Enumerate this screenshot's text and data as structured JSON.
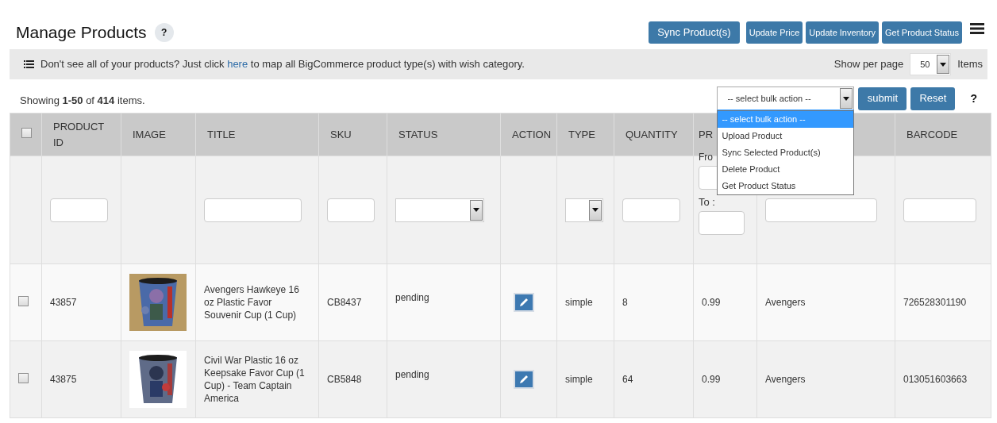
{
  "header": {
    "title": "Manage Products",
    "help": "?",
    "buttons": [
      {
        "label": "Sync Product(s)",
        "kind": "large"
      },
      {
        "label": "Update Price",
        "kind": "small"
      },
      {
        "label": "Update Inventory",
        "kind": "small"
      },
      {
        "label": "Get Product Status",
        "kind": "small"
      }
    ]
  },
  "notice": {
    "before": "Don't see all of your products? Just click",
    "link": "here",
    "after": "to map all BigCommerce product type(s) with wish category."
  },
  "per_page": {
    "label": "Show per page",
    "value": "50",
    "suffix": "Items"
  },
  "summary": "Showing **1-50** of **414** items.",
  "bulk": {
    "value": "-- select bulk action --",
    "expanded": true,
    "submit": "submit",
    "reset": "Reset",
    "help": "?",
    "options": [
      {
        "label": "-- select bulk action --",
        "selected": true
      },
      {
        "label": "Upload Product",
        "selected": false
      },
      {
        "label": "Sync Selected Product(s)",
        "selected": false
      },
      {
        "label": "Delete Product",
        "selected": false
      },
      {
        "label": "Get Product Status",
        "selected": false
      }
    ]
  },
  "table": {
    "select_all": {
      "checked": false
    },
    "columns": [
      {
        "kind": "checkbox"
      },
      {
        "label": "PRODUCT ID",
        "kind": "text"
      },
      {
        "label": "IMAGE"
      },
      {
        "label": "TITLE",
        "kind": "text"
      },
      {
        "label": "SKU",
        "kind": "text"
      },
      {
        "label": "STATUS",
        "kind": "text"
      },
      {
        "label": "ACTION",
        "kind": "action"
      },
      {
        "label": "TYPE",
        "kind": "text"
      },
      {
        "label": "QUANTITY",
        "kind": "text"
      },
      {
        "label": "PR",
        "kind": "text"
      },
      {
        "kind": "blank"
      },
      {
        "label": "BARCODE",
        "kind": "text"
      }
    ],
    "filters": [
      {
        "kind": "none"
      },
      {
        "kind": "text"
      },
      {
        "kind": "none"
      },
      {
        "kind": "text"
      },
      {
        "kind": "text"
      },
      {
        "kind": "select"
      },
      {
        "kind": "none"
      },
      {
        "kind": "small-select"
      },
      {
        "kind": "text"
      },
      {
        "kind": "range",
        "from_label": "Fro",
        "to_label": "To :"
      },
      {
        "kind": "text"
      },
      {
        "kind": "text"
      }
    ],
    "rows": [
      {
        "cells": [
          {
            "kind": "checkbox",
            "checked": false
          },
          "43857",
          {
            "kind": "picture"
          },
          "Avengers Hawkeye 16 oz Plastic Favor Souvenir Cup (1 Cup)",
          "CB8437",
          "pending",
          {
            "kind": "edit"
          },
          "simple",
          "8",
          "0.99",
          "Avengers",
          "726528301190"
        ]
      },
      {
        "cells": [
          {
            "kind": "checkbox",
            "checked": false
          },
          "43875",
          {
            "kind": "picture"
          },
          "Civil War Plastic 16 oz Keepsake Favor Cup (1 Cup) - Team Captain America",
          "CB5848",
          "pending",
          {
            "kind": "edit"
          },
          "simple",
          "64",
          "0.99",
          "Avengers",
          "013051603663"
        ]
      }
    ]
  }
}
